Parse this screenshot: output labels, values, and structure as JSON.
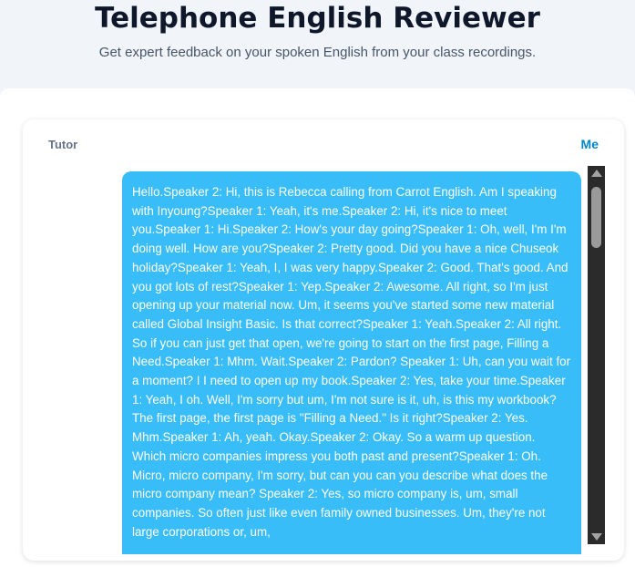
{
  "header": {
    "title": "Telephone English Reviewer",
    "subtitle": "Get expert feedback on your spoken English from your class recordings."
  },
  "chat": {
    "tutor_label": "Tutor",
    "me_label": "Me",
    "messages": [
      {
        "sender": "Me",
        "text": "Hello.Speaker 2: Hi, this is Rebecca calling from Carrot English. Am I speaking with Inyoung?Speaker 1: Yeah, it's me.Speaker 2: Hi, it's nice to meet you.Speaker 1: Hi.Speaker 2: How's your day going?Speaker 1: Oh, well, I'm I'm doing well. How are you?Speaker 2: Pretty good. Did you have a nice Chuseok holiday?Speaker 1: Yeah, I, I was very happy.Speaker 2: Good. That's good. And you got lots of rest?Speaker 1: Yep.Speaker 2: Awesome. All right, so I'm just opening up your material now. Um, it seems you've started some new material called Global Insight Basic. Is that correct?Speaker 1: Yeah.Speaker 2: All right. So if you can just get that open, we're going to start on the first page, Filling a Need.Speaker 1: Mhm. Wait.Speaker 2: Pardon? Speaker 1: Uh, can you wait for a moment? I I need to open up my book.Speaker 2: Yes, take your time.Speaker 1: Yeah, I oh. Well, I'm sorry but um, I'm not sure is it, uh, is this my workbook? The first page, the first page is \"Filling a Need.\" Is it right?Speaker 2: Yes. Mhm.Speaker 1: Ah, yeah. Okay.Speaker 2: Okay. So a warm up question. Which micro companies impress you both past and present?Speaker 1: Oh. Micro, micro company, I'm sorry, but can you can you describe what does the micro company mean? Speaker 2: Yes, so micro company is, um, small companies. So often just like even family owned businesses. Um, they're not large corporations or, um,"
      }
    ]
  },
  "colors": {
    "bubble_me": "#38bdf8",
    "accent": "#0284c7",
    "page_bg": "#f1f5f9"
  }
}
